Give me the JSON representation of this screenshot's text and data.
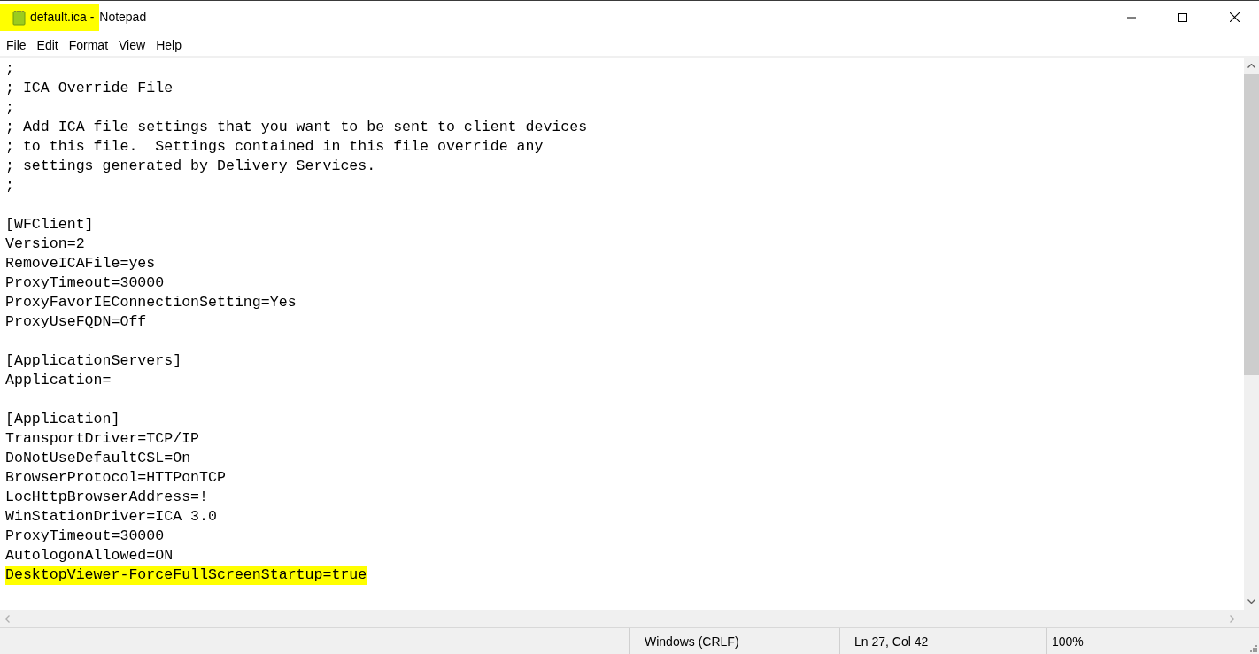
{
  "window": {
    "title_parts": [
      {
        "text": "default.ica - ",
        "highlighted": true
      },
      {
        "text": "Notepad",
        "highlighted": false
      }
    ]
  },
  "menu": [
    "File",
    "Edit",
    "Format",
    "View",
    "Help"
  ],
  "editor": {
    "lines": [
      {
        "kind": "text",
        "text": ";",
        "highlighted": false
      },
      {
        "kind": "text",
        "text": "; ICA Override File",
        "highlighted": false
      },
      {
        "kind": "text",
        "text": ";",
        "highlighted": false
      },
      {
        "kind": "text",
        "text": "; Add ICA file settings that you want to be sent to client devices",
        "highlighted": false
      },
      {
        "kind": "text",
        "text": "; to this file.  Settings contained in this file override any",
        "highlighted": false
      },
      {
        "kind": "text",
        "text": "; settings generated by Delivery Services.",
        "highlighted": false
      },
      {
        "kind": "text",
        "text": ";",
        "highlighted": false
      },
      {
        "kind": "blank"
      },
      {
        "kind": "text",
        "text": "[WFClient]",
        "highlighted": false
      },
      {
        "kind": "text",
        "text": "Version=2",
        "highlighted": false
      },
      {
        "kind": "text",
        "text": "RemoveICAFile=yes",
        "highlighted": false
      },
      {
        "kind": "text",
        "text": "ProxyTimeout=30000",
        "highlighted": false
      },
      {
        "kind": "text",
        "text": "ProxyFavorIEConnectionSetting=Yes",
        "highlighted": false
      },
      {
        "kind": "text",
        "text": "ProxyUseFQDN=Off",
        "highlighted": false
      },
      {
        "kind": "blank"
      },
      {
        "kind": "text",
        "text": "[ApplicationServers]",
        "highlighted": false
      },
      {
        "kind": "text",
        "text": "Application=",
        "highlighted": false
      },
      {
        "kind": "blank"
      },
      {
        "kind": "text",
        "text": "[Application]",
        "highlighted": false
      },
      {
        "kind": "text",
        "text": "TransportDriver=TCP/IP",
        "highlighted": false
      },
      {
        "kind": "text",
        "text": "DoNotUseDefaultCSL=On",
        "highlighted": false
      },
      {
        "kind": "text",
        "text": "BrowserProtocol=HTTPonTCP",
        "highlighted": false
      },
      {
        "kind": "text",
        "text": "LocHttpBrowserAddress=!",
        "highlighted": false
      },
      {
        "kind": "text",
        "text": "WinStationDriver=ICA 3.0",
        "highlighted": false
      },
      {
        "kind": "text",
        "text": "ProxyTimeout=30000",
        "highlighted": false
      },
      {
        "kind": "text",
        "text": "AutologonAllowed=ON",
        "highlighted": false
      },
      {
        "kind": "text",
        "text": "DesktopViewer-ForceFullScreenStartup=true",
        "highlighted": true,
        "caret": true
      },
      {
        "kind": "blank"
      }
    ]
  },
  "status_bar": {
    "line_ending": "Windows (CRLF)",
    "position": "Ln 27, Col 42",
    "zoom": "100%"
  }
}
